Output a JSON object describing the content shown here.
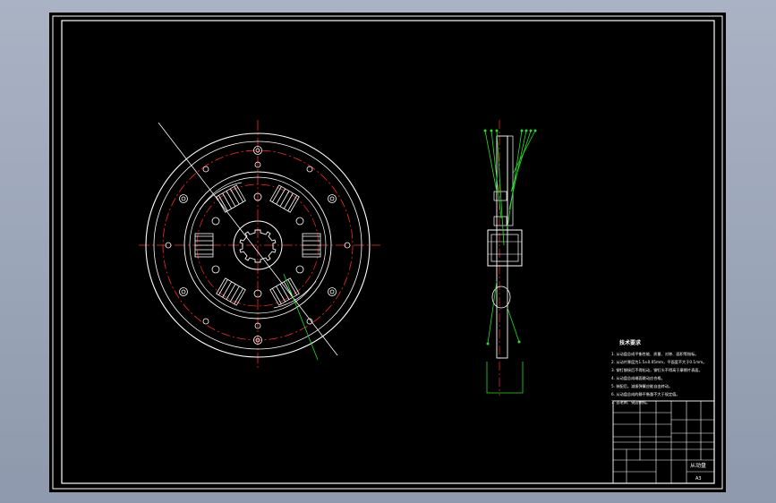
{
  "colors": {
    "background": "#000000",
    "frame": "#ffffff",
    "center_line": "#ff2a2a",
    "leader": "#25e025",
    "desktop": "#9aa4b6"
  },
  "technical_requirements": {
    "title": "技术要求",
    "lines": [
      "1. 从动盘总成平衡性能、质量、对称、面积等指标。",
      "2. 从动片厚度为1.5±0.05mm，平面度不大于0.1mm。",
      "3. 铆钉铆接后不得松动，铆钉头不得高于摩擦片表面。",
      "4. 从动盘总成端面跳动应合格。",
      "5. 装配后，减振弹簧应能自由转动。",
      "6. 从动盘总成的静平衡量不大于规定值。",
      "7. 去毛刺、锐边倒钝。"
    ]
  },
  "title_block": {
    "part_name": "从动盘",
    "scale": "A3"
  }
}
